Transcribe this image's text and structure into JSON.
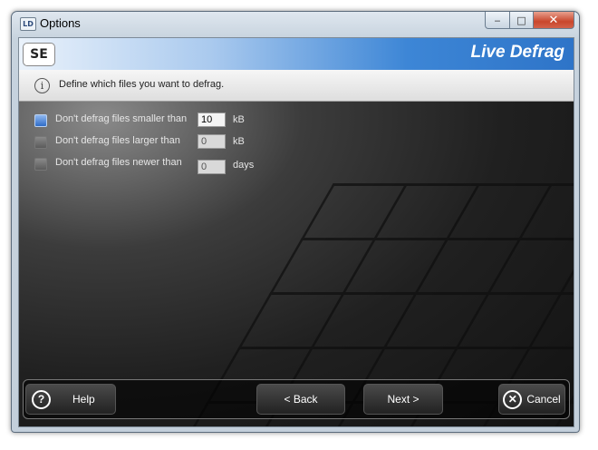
{
  "window": {
    "title": "Options",
    "app_icon": "LD",
    "minimize": "‒",
    "maximize": "□",
    "close": "✕"
  },
  "banner": {
    "logo": "SE",
    "brand": "Live Defrag"
  },
  "info": {
    "icon": "i",
    "text": "Define which files you want to defrag."
  },
  "options": [
    {
      "label": "Don't defrag files smaller than",
      "checked": true,
      "value": "10",
      "unit": "kB"
    },
    {
      "label": "Don't defrag files larger than",
      "checked": false,
      "value": "0",
      "unit": "kB"
    },
    {
      "label": "Don't defrag files newer than",
      "checked": false,
      "value": "0",
      "unit": "days"
    }
  ],
  "footer": {
    "help_icon": "?",
    "help": "Help",
    "back": "< Back",
    "next": "Next >",
    "cancel_icon": "✕",
    "cancel": "Cancel"
  },
  "colors": {
    "accent": "#2e74c8",
    "checked": "#2f6cc8",
    "background": "#1a1a1a"
  }
}
